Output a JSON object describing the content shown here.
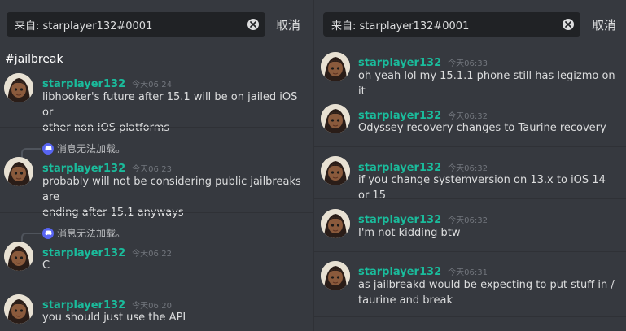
{
  "left": {
    "search": {
      "query": "来自: starplayer132#0001",
      "cancel_label": "取消"
    },
    "channel": "#jailbreak",
    "reply_label": "消息无法加载。",
    "messages": [
      {
        "author": "starplayer132",
        "time": "今天06:24",
        "lines": [
          "libhooker's future after 15.1 will be on jailed iOS or",
          "other non-iOS platforms"
        ]
      },
      {
        "author": "starplayer132",
        "time": "今天06:23",
        "lines": [
          "probably will not be considering public jailbreaks are",
          "ending after 15.1 anyways"
        ]
      },
      {
        "author": "starplayer132",
        "time": "今天06:22",
        "lines": [
          "C"
        ]
      },
      {
        "author": "starplayer132",
        "time": "今天06:20",
        "lines": [
          "you should just use the API"
        ]
      }
    ]
  },
  "right": {
    "search": {
      "query": "来自: starplayer132#0001",
      "cancel_label": "取消"
    },
    "messages": [
      {
        "author": "starplayer132",
        "time": "今天06:33",
        "lines": [
          "oh yeah lol my 15.1.1 phone still has legizmo on it"
        ]
      },
      {
        "author": "starplayer132",
        "time": "今天06:32",
        "lines": [
          "Odyssey recovery changes to Taurine recovery"
        ]
      },
      {
        "author": "starplayer132",
        "time": "今天06:32",
        "lines": [
          "if you change systemversion on 13.x to iOS 14 or 15"
        ]
      },
      {
        "author": "starplayer132",
        "time": "今天06:32",
        "lines": [
          "I'm not kidding btw"
        ]
      },
      {
        "author": "starplayer132",
        "time": "今天06:31",
        "lines": [
          "as jailbreakd would be expecting to put stuff in /",
          "taurine and break"
        ]
      }
    ]
  },
  "colors": {
    "author": "#1abc9c",
    "background": "#36393f",
    "search_bg": "#202225",
    "timestamp": "#72767d",
    "discord_icon": "#5865f2"
  },
  "icons": {
    "clear": "clear-search-icon",
    "reply": "discord-logo-icon",
    "avatar": "user-avatar"
  }
}
